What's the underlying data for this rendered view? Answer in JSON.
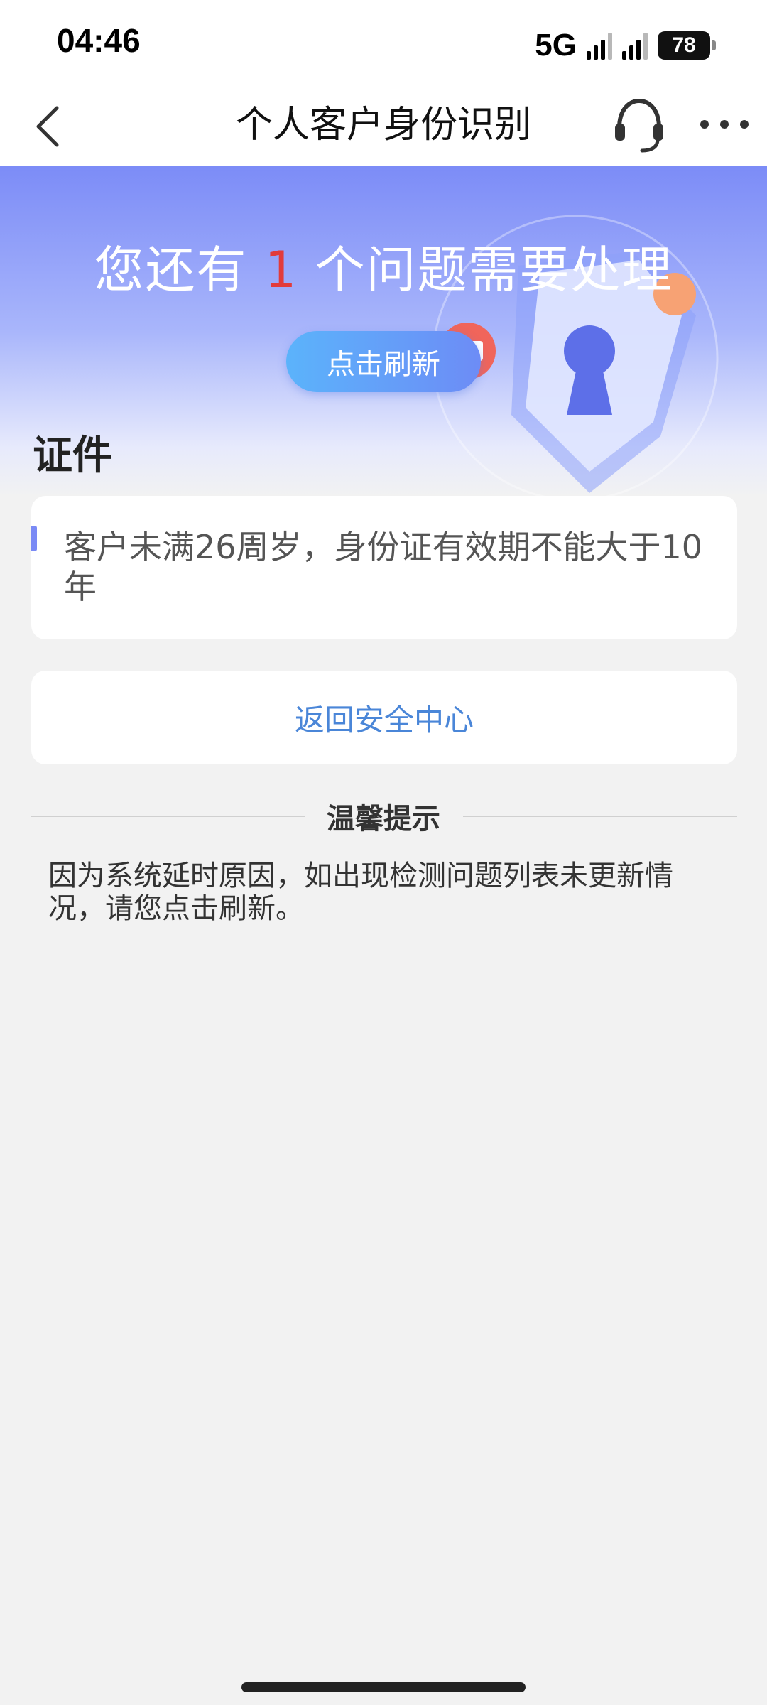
{
  "status_bar": {
    "time": "04:46",
    "network": "5G",
    "battery": "78"
  },
  "nav": {
    "title": "个人客户身份识别",
    "back_icon": "chevron-left-icon",
    "service_icon": "headset-icon",
    "more_icon": "more-horizontal-icon"
  },
  "hero": {
    "title_prefix": "您还有 ",
    "issue_count": "1",
    "title_suffix": " 个问题需要处理",
    "refresh_label": "点击刷新",
    "illustration": "security-shield-icon"
  },
  "section": {
    "title": "证件"
  },
  "issues": [
    {
      "text": "客户未满26周岁，身份证有效期不能大于10年"
    }
  ],
  "actions": {
    "back_to_security_center": "返回安全中心"
  },
  "tips": {
    "title": "温馨提示",
    "body": "因为系统延时原因，如出现检测问题列表未更新情况，请您点击刷新。"
  },
  "colors": {
    "accent": "#6d8cf6",
    "issue_count": "#e23b3b",
    "link": "#4a86d8",
    "background": "#f2f2f2"
  }
}
